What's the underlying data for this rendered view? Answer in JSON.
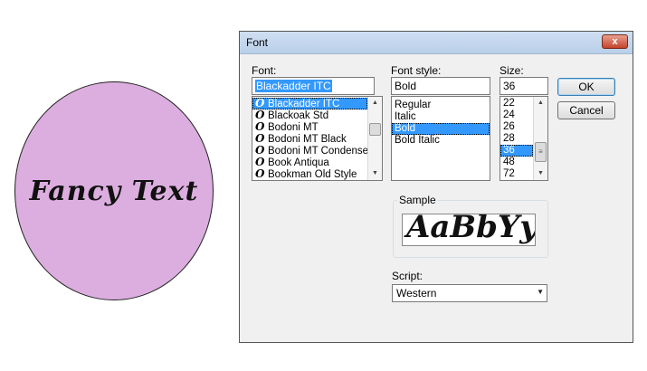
{
  "canvas": {
    "circle_text": "Fancy Text",
    "circle_color": "#dcaedf"
  },
  "dialog": {
    "title": "Font",
    "close_label": "x",
    "font": {
      "label": "Font:",
      "value": "Blackadder ITC",
      "items": [
        "Blackadder ITC",
        "Blackoak Std",
        "Bodoni MT",
        "Bodoni MT Black",
        "Bodoni MT Condensed",
        "Book Antiqua",
        "Bookman Old Style"
      ],
      "glyph": "O",
      "selected_index": 0
    },
    "style": {
      "label": "Font style:",
      "value": "Bold",
      "items": [
        "Regular",
        "Italic",
        "Bold",
        "Bold Italic"
      ],
      "selected_index": 2
    },
    "size": {
      "label": "Size:",
      "value": "36",
      "items": [
        "22",
        "24",
        "26",
        "28",
        "36",
        "48",
        "72"
      ],
      "selected_index": 4
    },
    "ok_label": "OK",
    "cancel_label": "Cancel",
    "sample": {
      "label": "Sample",
      "text": "AaBbYy"
    },
    "script": {
      "label": "Script:",
      "value": "Western"
    }
  },
  "colors": {
    "selection": "#3399ff",
    "titlebar": "#c5d8ee"
  },
  "icons": {
    "close": "close-icon",
    "scroll_up": "scroll-up-icon",
    "scroll_down": "scroll-down-icon",
    "dropdown": "chevron-down-icon",
    "font_type": "opentype-font-icon"
  }
}
